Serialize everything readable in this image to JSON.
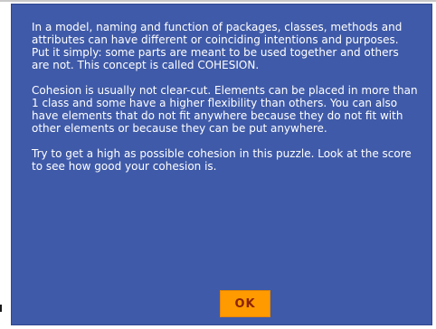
{
  "dialog": {
    "paragraphs": [
      "In a model, naming and function of packages, classes, methods and attributes can have different or coinciding intentions and purposes. Put it simply: some parts are meant to be used together and others are not. This concept is called COHESION.",
      "Cohesion is usually not clear-cut. Elements can be placed in more than 1 class and some have a higher flexibility than others. You can also have elements that do not fit anywhere because they do not fit with other elements or because they can be put anywhere.",
      "Try to get a high as possible cohesion in this puzzle. Look at the score to see how good your cohesion is."
    ],
    "ok_label": "OK"
  },
  "colors": {
    "dialog_background": "#3f5aa8",
    "button_background": "#ff9a00",
    "button_text": "#8b2300",
    "text": "#ffffff"
  }
}
